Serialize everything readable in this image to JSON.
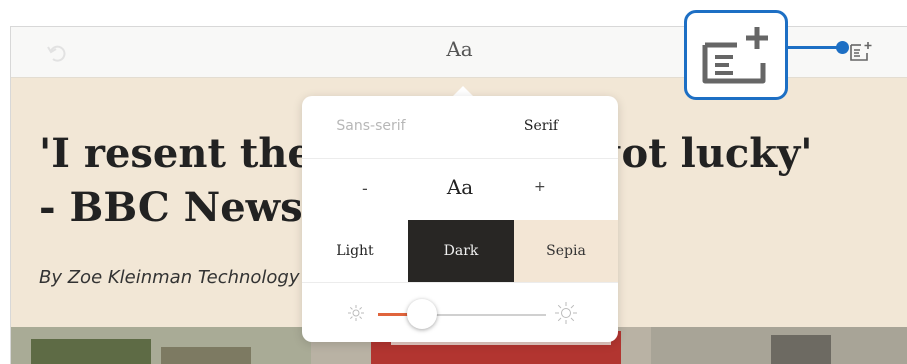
{
  "toolbar": {
    "title": "Aa",
    "back_icon": "back-arrow-icon",
    "add_icon": "add-to-reading-list-icon"
  },
  "article": {
    "headline_line1": "'I resent the people who got lucky'",
    "headline_line2": "- BBC News",
    "byline": "By Zoe Kleinman Technology reporter"
  },
  "popover": {
    "fonts": [
      "Sans-serif",
      "Serif"
    ],
    "selected_font": "Serif",
    "size_decrease": "-",
    "size_label": "Aa",
    "size_increase": "+",
    "themes": [
      "Light",
      "Dark",
      "Sepia"
    ],
    "selected_theme": "Dark",
    "brightness_fraction": 0.26
  },
  "colors": {
    "accent": "#e0643c",
    "callout": "#1d6fc4",
    "dark_theme": "#282624",
    "sepia_theme": "#f3e6d5",
    "page_background": "#f2e7d6"
  }
}
